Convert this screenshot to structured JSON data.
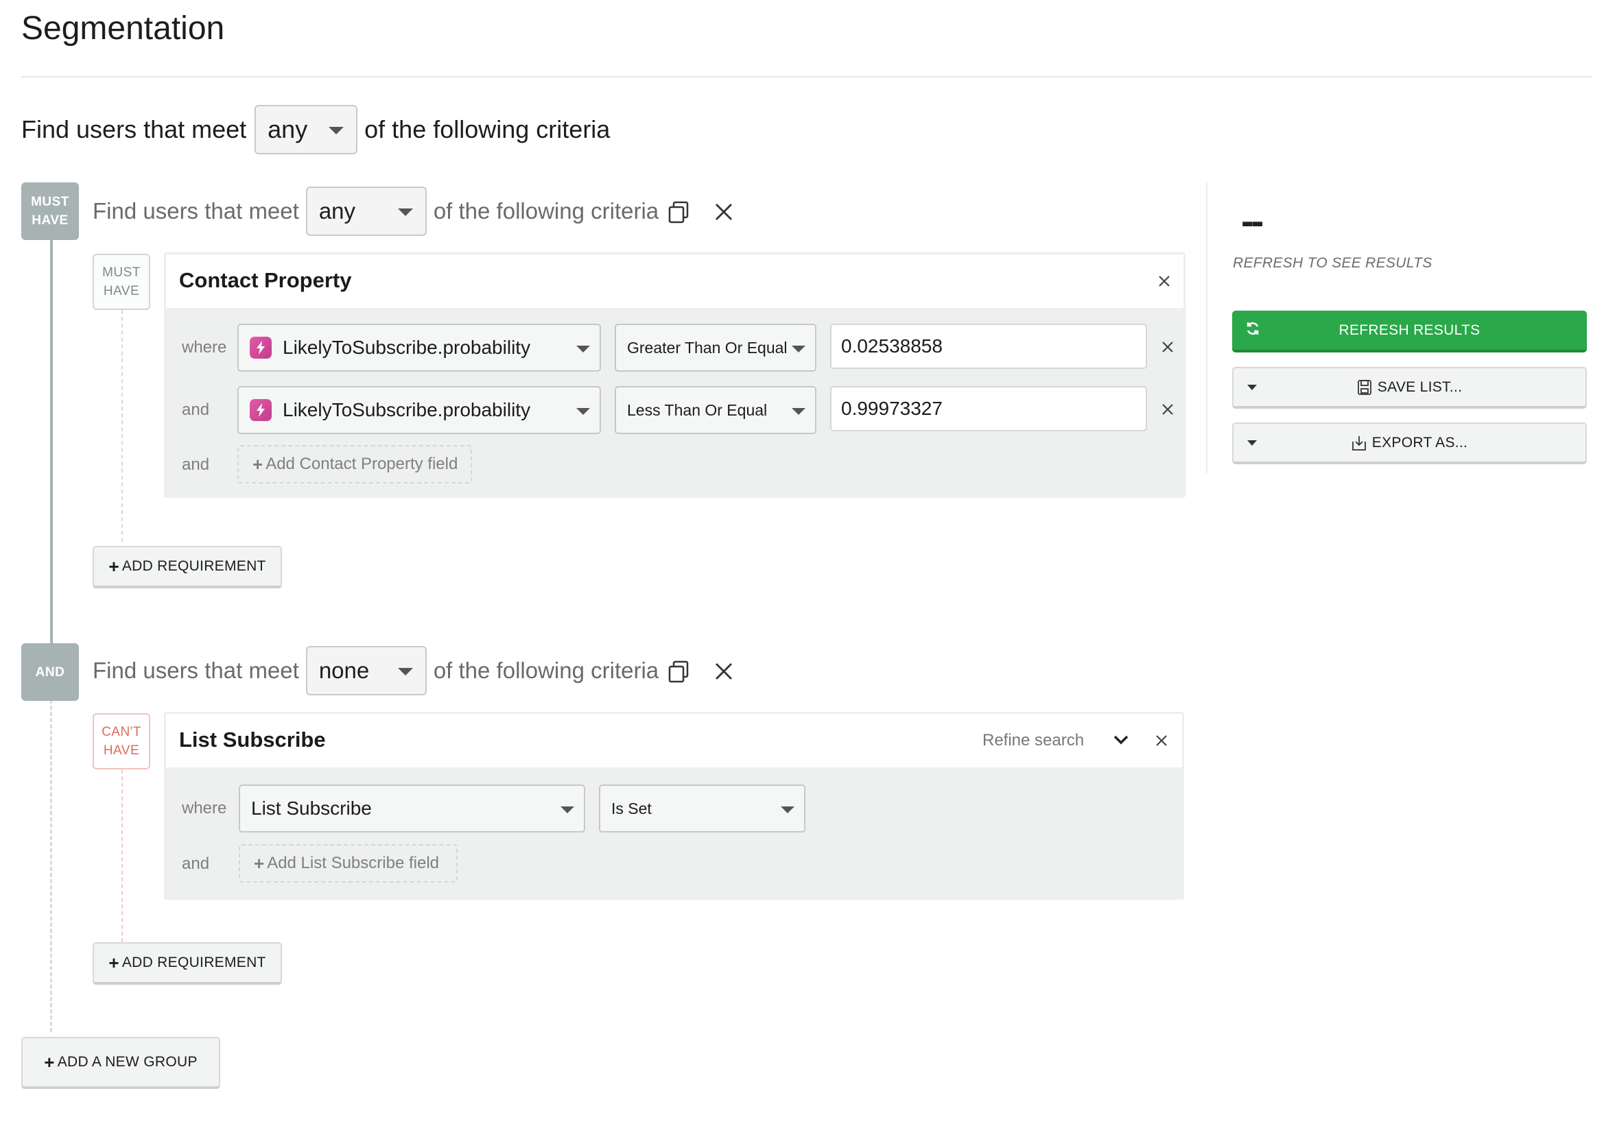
{
  "page": {
    "title": "Segmentation"
  },
  "top": {
    "prefix": "Find users that meet",
    "select": "any",
    "suffix": "of the following criteria"
  },
  "groups": [
    {
      "badge": "MUST\nHAVE",
      "prefix": "Find users that meet",
      "select": "any",
      "suffix": "of the following criteria",
      "requirement": {
        "badge": "MUST\nHAVE",
        "title": "Contact Property",
        "rows": [
          {
            "label": "where",
            "property": "LikelyToSubscribe.probability",
            "operator": "Greater Than Or Equal",
            "value": "0.02538858"
          },
          {
            "label": "and",
            "property": "LikelyToSubscribe.probability",
            "operator": "Less Than Or Equal",
            "value": "0.99973327"
          }
        ],
        "add_label": "and",
        "add_field": "Add Contact Property field"
      },
      "add_requirement": "ADD REQUIREMENT"
    },
    {
      "badge": "AND",
      "prefix": "Find users that meet",
      "select": "none",
      "suffix": "of the following criteria",
      "requirement": {
        "badge": "CAN'T\nHAVE",
        "title": "List Subscribe",
        "refine": "Refine search",
        "rows": [
          {
            "label": "where",
            "property": "List Subscribe",
            "operator": "Is Set"
          }
        ],
        "add_label": "and",
        "add_field": "Add List Subscribe field"
      },
      "add_requirement": "ADD REQUIREMENT"
    }
  ],
  "add_group": "ADD A NEW GROUP",
  "results": {
    "count": "--",
    "note": "REFRESH TO SEE RESULTS",
    "refresh": "REFRESH RESULTS",
    "save": "SAVE LIST...",
    "export": "EXPORT AS..."
  },
  "colors": {
    "primary_green": "#2aa84a",
    "badge_gray": "#a7b2b2",
    "cant_red": "#dc6b5f",
    "property_icon": "#d94b9f"
  },
  "icons": [
    "copy-icon",
    "close-icon",
    "lightning-icon",
    "chevron-down-icon",
    "refresh-icon",
    "save-icon",
    "download-icon",
    "plus-icon"
  ]
}
